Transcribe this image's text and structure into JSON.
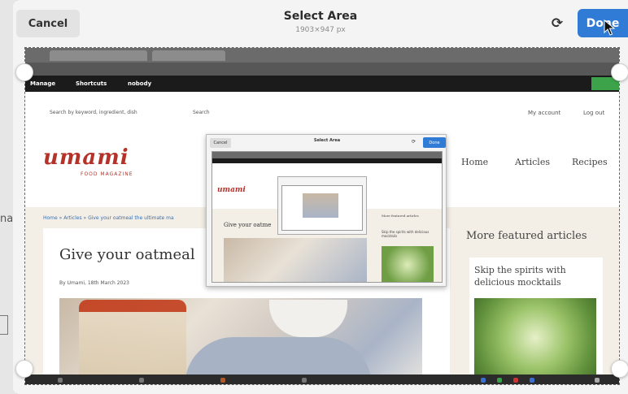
{
  "background": {
    "partial_text": "na"
  },
  "dialog": {
    "cancel_label": "Cancel",
    "title": "Select Area",
    "subtitle": "1903×947 px",
    "refresh_icon": "⟳",
    "done_label": "Done",
    "accent_color": "#2f7bd6"
  },
  "captured_page": {
    "admin_bar": {
      "manage": "Manage",
      "shortcuts": "Shortcuts",
      "user": "nobody"
    },
    "search_placeholder": "Search by keyword, ingredient, dish",
    "search_button": "Search",
    "account_links": {
      "my_account": "My account",
      "logout": "Log out"
    },
    "logo": {
      "name": "umami",
      "tagline": "FOOD MAGAZINE",
      "color": "#b4322a"
    },
    "nav": {
      "home": "Home",
      "articles": "Articles",
      "recipes": "Recipes"
    },
    "breadcrumb": "Home » Articles » Give your oatmeal the ultimate ma",
    "article": {
      "headline": "Give your oatmeal",
      "byline": "By Umami, 18th March 2023"
    },
    "featured": {
      "heading": "More featured articles",
      "card_title": "Skip the spirits with delicious mocktails"
    }
  },
  "nested_preview": {
    "cancel_label": "Cancel",
    "title": "Select Area",
    "done_label": "Done",
    "logo": "umami",
    "headline": "Give your oatme",
    "featured": "More featured articles",
    "card_title": "Skip the spirits with delicious mocktails"
  }
}
